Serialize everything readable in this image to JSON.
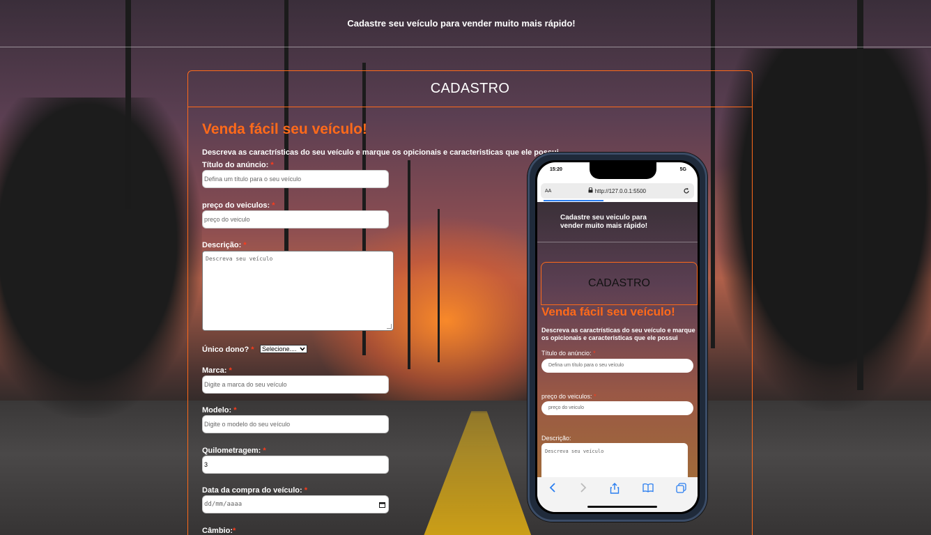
{
  "header": {
    "title": "Cadastre seu veículo para vender muito mais rápido!"
  },
  "card": {
    "title": "CADASTRO",
    "headline": "Venda fácil seu veículo!",
    "subtitle": "Descreva as caractrísticas do seu veículo e marque os opicionais e caracteristicas que ele possui"
  },
  "form": {
    "required_mark": "*",
    "titulo": {
      "label": "Título do anúncio:",
      "placeholder": "Defina um título para o seu veículo"
    },
    "preco": {
      "label": "preço do veiculos:",
      "placeholder": "preço do veiculo"
    },
    "descricao": {
      "label": "Descrição:",
      "placeholder": "Descreva seu veículo"
    },
    "unico_dono": {
      "label": "Único dono?",
      "selected": "Selecione...."
    },
    "marca": {
      "label": "Marca:",
      "placeholder": "Digite a marca do seu veículo"
    },
    "modelo": {
      "label": "Modelo:",
      "placeholder": "Digite o modelo do seu veículo"
    },
    "quilometragem": {
      "label": "Quilometragem:",
      "value": "3"
    },
    "data_compra": {
      "label": "Data da compra do veículo:",
      "placeholder": "dd/mm/aaaa"
    },
    "cambio": {
      "label": "Câmbio:"
    }
  },
  "phone": {
    "time": "15:20",
    "signal": "5G",
    "url_aa": "AA",
    "url": "http://127.0.0.1:5500",
    "header_title": "Cadastre seu veiculo para vender muito mais rápido!",
    "card_title": "CADASTRO",
    "headline": "Venda fácil seu veículo!",
    "subtitle": "Descreva as caractrísticas do seu veículo e marque os opicionais e caracteristicas que ele possui",
    "titulo_label": "Título do anúncio:",
    "titulo_placeholder": "Defina um título para o seu veículo",
    "preco_label": "preço do veiculos:",
    "preco_placeholder": "preço do veiculo",
    "descricao_label": "Descrição:",
    "descricao_placeholder": "Descreva seu veículo"
  },
  "icons": [
    "lock-icon",
    "reload-icon",
    "back-icon",
    "forward-icon",
    "share-icon",
    "bookmarks-icon",
    "tabs-icon",
    "calendar-icon",
    "chevron-down-icon"
  ],
  "colors": {
    "accent": "#ff6a1a",
    "required": "#ff3b1a",
    "link": "#2a7ef0"
  }
}
